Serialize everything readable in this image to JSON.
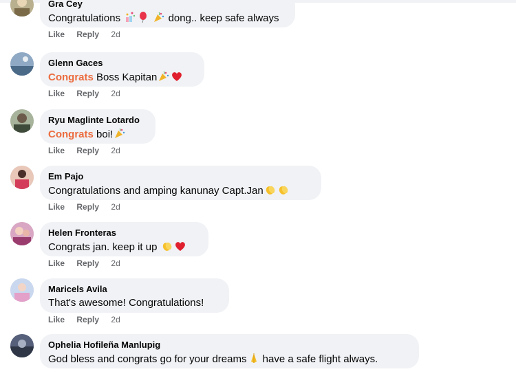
{
  "actions": {
    "like_label": "Like",
    "reply_label": "Reply"
  },
  "comments": [
    {
      "author": "Gra Cey",
      "text_before": "Congratulations",
      "text_after": "dong.. keep safe always",
      "mention": "",
      "emojis": [
        "confetti-icon",
        "balloon-icon",
        "party-popper-icon"
      ],
      "time": "2d"
    },
    {
      "author": "Glenn Gaces",
      "mention": "Congrats",
      "text_before": "Boss Kapitan",
      "text_after": "",
      "emojis": [
        "party-popper-icon",
        "red-heart-icon"
      ],
      "time": "2d"
    },
    {
      "author": "Ryu Maglinte Lotardo",
      "mention": "Congrats",
      "text_before": "boi!",
      "text_after": "",
      "emojis": [
        "party-popper-icon"
      ],
      "time": "2d"
    },
    {
      "author": "Em Pajo",
      "mention": "",
      "text_before": "Congratulations and amping kanunay Capt.Jan",
      "text_after": "",
      "emojis": [
        "clapping-hands-icon",
        "clapping-hands-icon"
      ],
      "time": "2d"
    },
    {
      "author": "Helen Fronteras",
      "mention": "",
      "text_before": "Congrats jan. keep it up",
      "text_after": "",
      "emojis": [
        "clapping-hands-icon",
        "red-heart-icon"
      ],
      "time": "2d"
    },
    {
      "author": "Maricels Avila",
      "mention": "",
      "text_before": "That's awesome! Congratulations!",
      "text_after": "",
      "emojis": [],
      "time": "2d"
    },
    {
      "author": "Ophelia Hofileña Manlupig",
      "mention": "",
      "text_before": "God bless and congrats go for your dreams",
      "text_after": "have a safe flight always.",
      "emojis": [
        "folded-hands-icon"
      ],
      "time": ""
    }
  ],
  "colors": {
    "bubble": "#f0f2f5",
    "mention": "#ec6b3e",
    "secondary_text": "#65676b",
    "primary_text": "#050505"
  }
}
